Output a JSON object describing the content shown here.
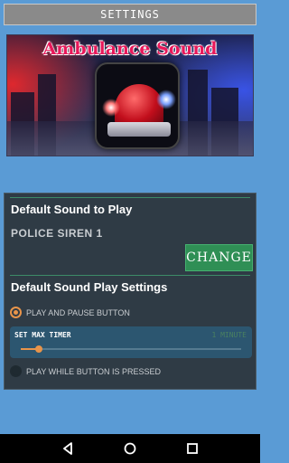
{
  "header": {
    "title": "SETTINGS"
  },
  "banner": {
    "title": "Ambulance Sound"
  },
  "sound_section": {
    "title": "Default Sound to Play",
    "current_sound": "POLICE SIREN 1",
    "change_label": "CHANGE"
  },
  "play_section": {
    "title": "Default Sound Play Settings",
    "option_play_pause": {
      "label": "PLAY AND PAUSE BUTTON",
      "selected": true
    },
    "timer": {
      "label": "SET MAX TIMER",
      "value_text": "1 MINUTE",
      "level": 0.08
    },
    "option_hold": {
      "label": "PLAY WHILE BUTTON IS PRESSED",
      "selected": false
    }
  },
  "colors": {
    "background": "#5a9bd5",
    "panel": "#2f3b45",
    "accent_orange": "#e8944a",
    "button_green": "#2f8f55"
  },
  "navbar": {
    "icons": [
      "back-icon",
      "home-icon",
      "recents-icon"
    ]
  }
}
